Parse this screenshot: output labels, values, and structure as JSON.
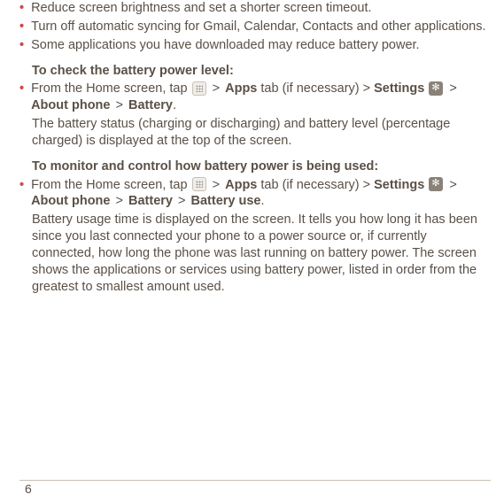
{
  "bullets": {
    "b1": "Reduce screen brightness and set a shorter screen timeout.",
    "b2": "Turn off automatic syncing for Gmail, Calendar, Contacts and other applications.",
    "b3": "Some applications you have downloaded may reduce battery power."
  },
  "heading1": "To check the battery power level:",
  "path1": {
    "prefix": "From the Home screen, tap ",
    "gt0": " > ",
    "apps": "Apps",
    "tab_if": " tab (if necessary) > ",
    "settings": "Settings",
    "gt1": " > ",
    "about": "About phone",
    "gt2": " > ",
    "battery": "Battery",
    "dot": "."
  },
  "para1": "The battery status (charging or discharging) and battery level (percentage charged) is displayed at the top of the screen.",
  "heading2": "To monitor and control how battery power is being used:",
  "path2": {
    "prefix": "From the Home screen, tap ",
    "gt0": " > ",
    "apps": "Apps",
    "tab_if": " tab (if necessary) > ",
    "settings": "Settings",
    "gt1": " > ",
    "about": "About phone",
    "gt2": " > ",
    "battery": "Battery",
    "gt3": " > ",
    "battery_use": "Battery use",
    "dot": "."
  },
  "para2": "Battery usage time is displayed on the screen. It tells you how long it has been since you last connected your phone to a power source or, if currently connected, how long the phone was last running on battery power. The screen shows the applications or services using battery power, listed in order from the greatest to smallest amount used.",
  "pageNumber": "6",
  "bullet_char": "•"
}
